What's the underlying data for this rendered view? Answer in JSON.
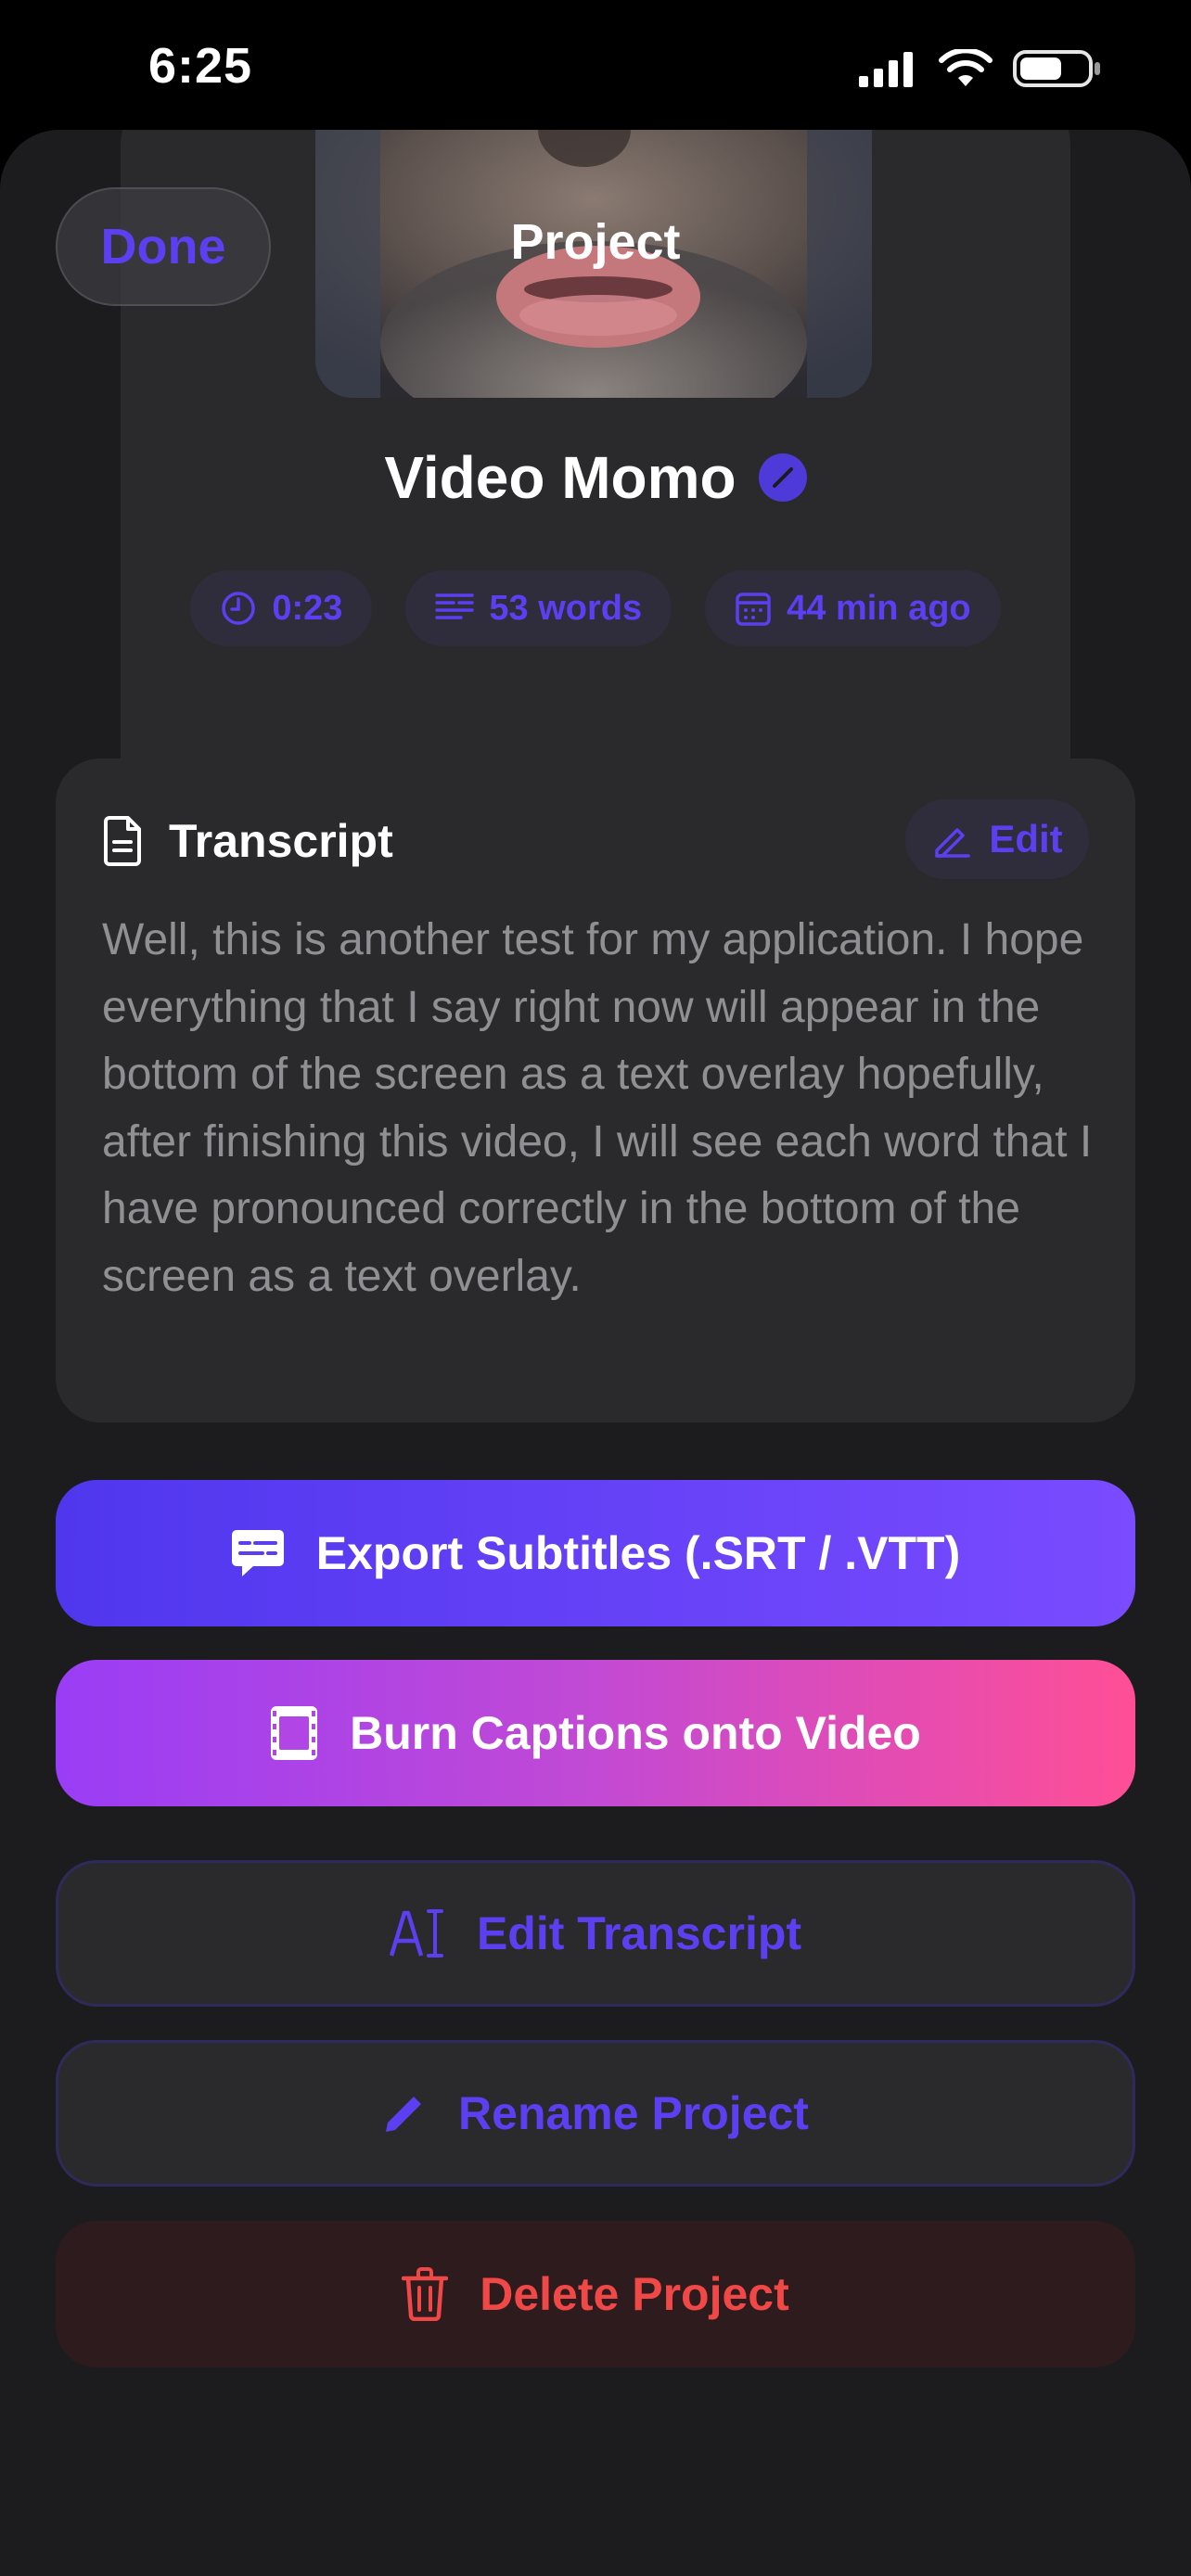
{
  "status_bar": {
    "time": "6:25"
  },
  "nav": {
    "done_label": "Done",
    "title": "Project"
  },
  "project": {
    "name": "Video Momo",
    "duration": "0:23",
    "words": "53 words",
    "created": "44 min ago"
  },
  "transcript": {
    "title": "Transcript",
    "edit_label": "Edit",
    "text": "Well, this is another test for my application. I hope everything that I say right now will appear in the bottom of the screen as a text overlay hopefully, after finishing this video, I will see each word that I have pronounced correctly in the bottom of the screen as a text overlay."
  },
  "actions": {
    "export_label": "Export Subtitles (.SRT / .VTT)",
    "burn_label": "Burn Captions onto Video",
    "edit_transcript_label": "Edit Transcript",
    "rename_label": "Rename Project",
    "delete_label": "Delete Project"
  },
  "colors": {
    "accent": "#5b3ff0",
    "destructive": "#f04747",
    "background": "#1c1c1e",
    "card": "#2a2a2d"
  },
  "icons": {
    "duration": "clock-icon",
    "words": "text-lines-icon",
    "created": "calendar-icon",
    "transcript": "document-icon",
    "edit": "pencil-icon",
    "export": "subtitles-icon",
    "burn": "film-icon",
    "edit_transcript": "text-cursor-icon",
    "rename": "pencil-icon",
    "delete": "trash-icon"
  }
}
